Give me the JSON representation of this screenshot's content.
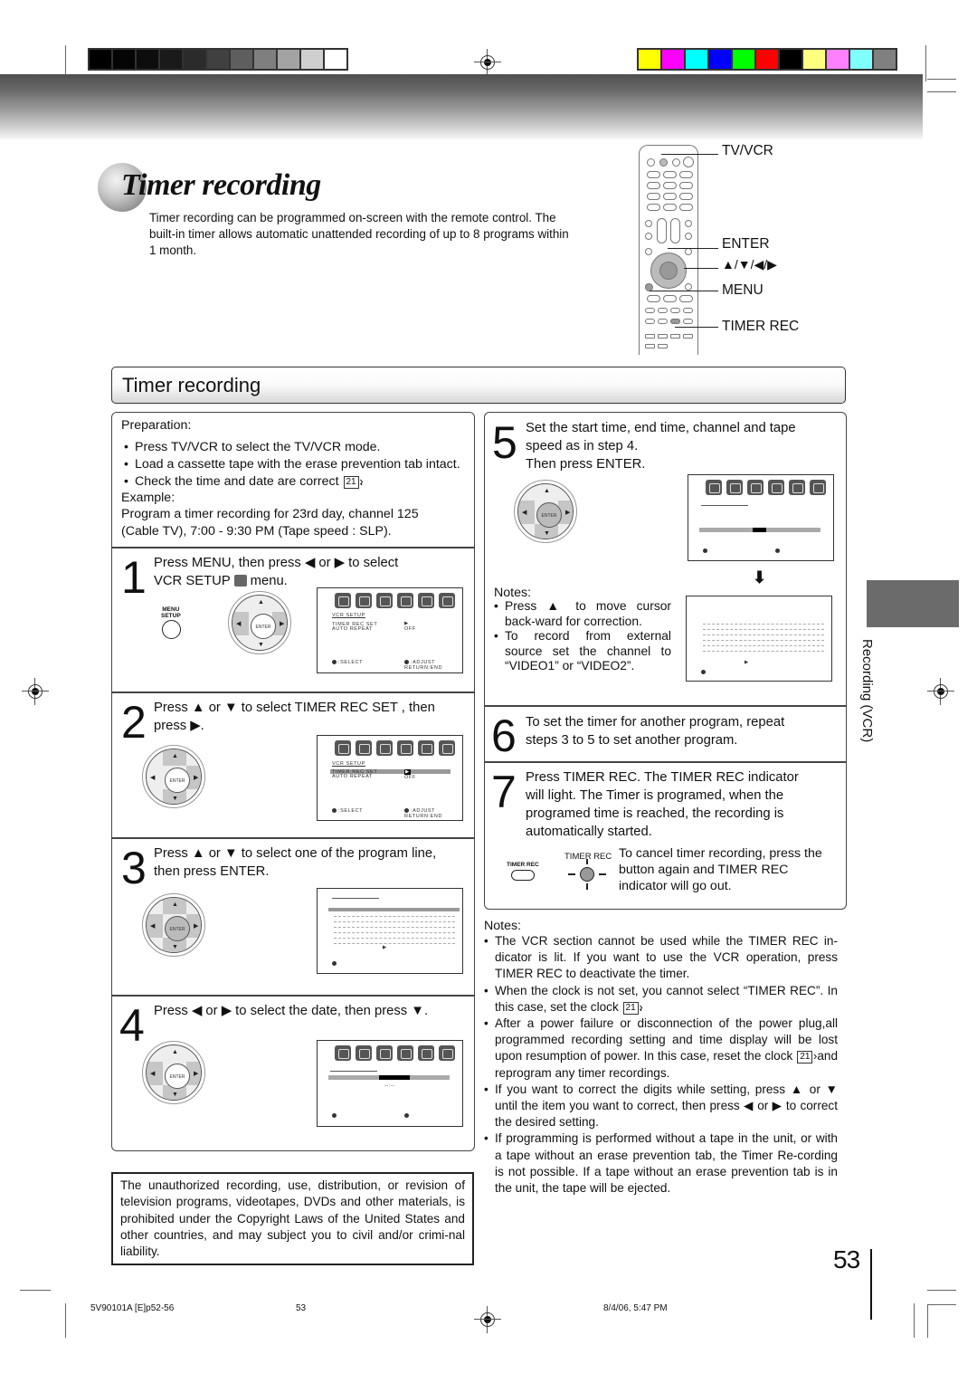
{
  "calibration": {
    "gray_swatches": [
      "#000000",
      "#050505",
      "#0d0d0d",
      "#1a1a1a",
      "#2b2b2b",
      "#404040",
      "#5e5e5e",
      "#7f7f7f",
      "#a3a3a3",
      "#cfcfcf",
      "#ffffff"
    ],
    "color_swatches": [
      "#ffff00",
      "#ff00ff",
      "#00ffff",
      "#0000ff",
      "#00ff00",
      "#ff0000",
      "#000000",
      "#ffff80",
      "#ff80ff",
      "#80ffff",
      "#808080"
    ]
  },
  "header": {
    "title": "Timer recording",
    "intro": "Timer recording can be programmed on-screen with the remote control. The built-in timer allows automatic unattended recording of up to 8 programs within 1 month."
  },
  "remote": {
    "callouts": [
      "TV/VCR",
      "ENTER",
      "▲/▼/◀/▶",
      "MENU",
      "TIMER REC"
    ]
  },
  "section": {
    "title": "Timer recording"
  },
  "preparation": {
    "heading": "Preparation:",
    "bullets": [
      "Press TV/VCR to select the TV/VCR mode.",
      "Load a cassette tape with the erase prevention tab intact.",
      "Check the time and date are correct"
    ],
    "ref_page": "21",
    "example_heading": "Example:",
    "example_text": "Program a timer recording for 23rd day, channel 125 (Cable TV), 7:00 - 9:30 PM (Tape speed : SLP)."
  },
  "steps": [
    {
      "num": "1",
      "text_a": "Press MENU, then press  ◀ or ▶ to select",
      "text_b": "VCR SETUP",
      "text_c": "menu.",
      "button_label": "MENU\nSETUP"
    },
    {
      "num": "2",
      "text_a": "Press ▲ or ▼ to select  TIMER REC SET , then",
      "text_b": "press  ▶."
    },
    {
      "num": "3",
      "text_a": "Press ▲ or ▼ to select one of the program line,",
      "text_b": "then press ENTER."
    },
    {
      "num": "4",
      "text_a": "Press ◀ or ▶ to select the date, then press    ▼."
    },
    {
      "num": "5",
      "text_a": "Set the start time, end time, channel and tape",
      "text_b": "speed as in step 4.",
      "text_c": "Then press ENTER."
    },
    {
      "num": "6",
      "text_a": "To set the timer for another program, repeat",
      "text_b": "steps 3 to 5 to set another program."
    },
    {
      "num": "7",
      "text": "Press TIMER REC. The TIMER REC indicator will light. The Timer is programed, when the programed time is reached, the recording is automatically started.",
      "button_label": "TIMER REC",
      "indicator_label": "TIMER REC",
      "cancel_text": "To cancel timer recording, press the button again and TIMER REC indicator will go out."
    }
  ],
  "osd": {
    "menu_title": "VCR SETUP",
    "items": [
      "TIMER REC SET",
      "AUTO REPEAT"
    ],
    "values": [
      "▶",
      "OFF"
    ],
    "select_hint": ":SELECT",
    "adjust_hint": ":ADJUST",
    "return_hint": "RETURN:END",
    "time_placeholder": "--:--"
  },
  "dpad": {
    "center_label": "ENTER"
  },
  "step5_notes": {
    "heading": "Notes:",
    "items": [
      "Press ▲ to move cursor back-ward for correction.",
      "To record from external source set the channel to “VIDEO1” or “VIDEO2”."
    ]
  },
  "notes": {
    "heading": "Notes:",
    "items": [
      "The VCR section cannot be used while the TIMER REC in-dicator is lit. If you want to use the VCR operation, press TIMER REC to deactivate the timer.",
      "When the clock is not set, you cannot select “TIMER REC”. In this case, set the clock",
      "After a power failure or disconnection of the power plug,all programmed recording setting and time display will be  lost upon resumption of power. In this case, reset the clock",
      "If you want to correct the digits while setting, press ▲ or ▼ until the item you want to correct, then press ◀ or ▶ to correct the desired setting.",
      "If programming is performed without a tape in the unit, or with a tape without an erase prevention tab, the Timer Re-cording is not possible. If a tape without an erase prevention tab is in the unit, the tape will be ejected."
    ],
    "ref_page": "21",
    "after_ref": "and reprogram any timer recordings."
  },
  "disclaimer": "The unauthorized recording, use, distribution, or revision of television programs, videotapes, DVDs and other materials, is prohibited under the Copyright Laws of the United States and other countries, and may subject you to civil and/or crimi-nal liability.",
  "side_tab": {
    "label": "Recording (VCR)",
    "color": "#6b6b6b"
  },
  "page_number": "53",
  "footer": {
    "doc_id": "5V90101A [E]p52-56",
    "page": "53",
    "timestamp": "8/4/06, 5:47 PM"
  }
}
